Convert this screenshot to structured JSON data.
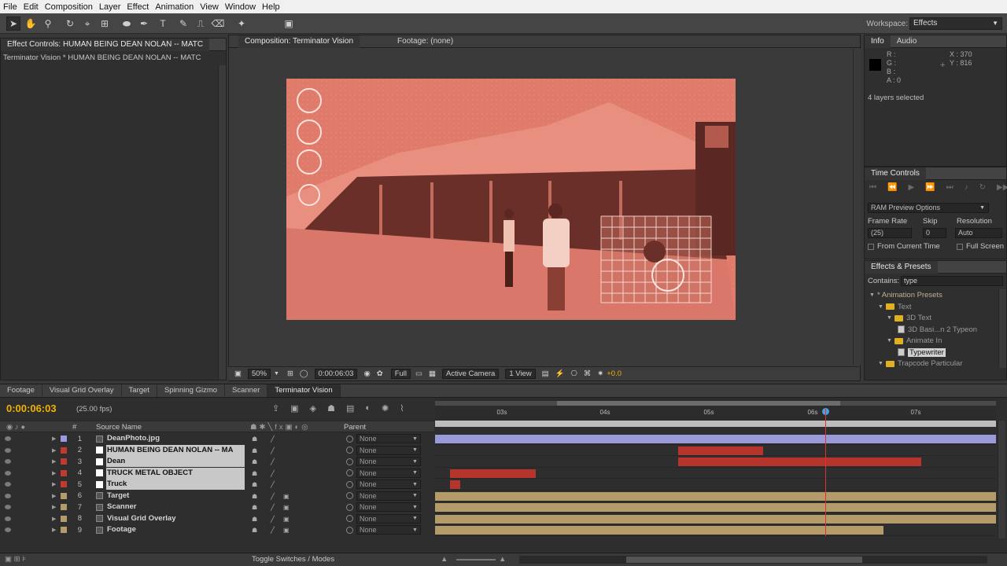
{
  "menu": [
    "File",
    "Edit",
    "Composition",
    "Layer",
    "Effect",
    "Animation",
    "View",
    "Window",
    "Help"
  ],
  "workspace": {
    "label": "Workspace:",
    "value": "Effects"
  },
  "effect_controls": {
    "tab": "Effect Controls: HUMAN BEING DEAN NOLAN -- MATC",
    "subtitle": "Terminator Vision * HUMAN BEING DEAN NOLAN -- MATC"
  },
  "composition": {
    "tab": "Composition: Terminator Vision",
    "footage_tab": "Footage: (none)"
  },
  "viewer_bar": {
    "zoom": "50%",
    "timecode": "0:00:06:03",
    "resolution": "Full",
    "camera": "Active Camera",
    "views": "1 View",
    "exposure": "+0.0"
  },
  "info": {
    "tabs": [
      "Info",
      "Audio"
    ],
    "r": "R :",
    "g": "G :",
    "b": "B :",
    "a": "A : 0",
    "x": "X : 370",
    "y": "Y : 816",
    "status": "4 layers selected"
  },
  "time_controls": {
    "tab": "Time Controls"
  },
  "ram_preview": {
    "title": "RAM Preview Options",
    "frame_rate_label": "Frame Rate",
    "skip_label": "Skip",
    "resolution_label": "Resolution",
    "frame_rate": "(25)",
    "skip": "0",
    "resolution": "Auto",
    "from_current": "From Current Time",
    "full_screen": "Full Screen"
  },
  "effects_presets": {
    "tab": "Effects & Presets",
    "contains_label": "Contains:",
    "contains_value": "type",
    "tree": [
      {
        "label": "* Animation Presets",
        "indent": 0,
        "kind": "root"
      },
      {
        "label": "Text",
        "indent": 1,
        "kind": "folder"
      },
      {
        "label": "3D Text",
        "indent": 2,
        "kind": "folder"
      },
      {
        "label": "3D Basi...n 2 Typeon",
        "indent": 3,
        "kind": "file"
      },
      {
        "label": "Animate In",
        "indent": 2,
        "kind": "folder"
      },
      {
        "label": "Typewriter",
        "indent": 3,
        "kind": "file",
        "selected": true
      },
      {
        "label": "Trapcode Particular",
        "indent": 1,
        "kind": "folder"
      }
    ]
  },
  "timeline": {
    "tabs": [
      "Footage",
      "Visual Grid Overlay",
      "Target",
      "Spinning Gizmo",
      "Scanner",
      "Terminator Vision"
    ],
    "active_tab": "Terminator Vision",
    "timecode": "0:00:06:03",
    "fps": "(25.00 fps)",
    "headers": {
      "num": "#",
      "source": "Source Name",
      "parent": "Parent"
    },
    "ticks": [
      "03s",
      "04s",
      "05s",
      "06s",
      "07s"
    ],
    "layers": [
      {
        "num": "1",
        "name": "DeanPhoto.jpg",
        "label": "#9a9ae0",
        "selected": false,
        "parent": "None"
      },
      {
        "num": "2",
        "name": "HUMAN BEING DEAN NOLAN -- MA",
        "label": "#c03a30",
        "selected": true,
        "parent": "None"
      },
      {
        "num": "3",
        "name": "Dean",
        "label": "#c03a30",
        "selected": true,
        "parent": "None"
      },
      {
        "num": "4",
        "name": "TRUCK METAL OBJECT",
        "label": "#c03a30",
        "selected": true,
        "parent": "None"
      },
      {
        "num": "5",
        "name": "Truck",
        "label": "#c03a30",
        "selected": true,
        "parent": "None"
      },
      {
        "num": "6",
        "name": "Target",
        "label": "#b59a6a",
        "selected": false,
        "parent": "None"
      },
      {
        "num": "7",
        "name": "Scanner",
        "label": "#b59a6a",
        "selected": false,
        "parent": "None"
      },
      {
        "num": "8",
        "name": "Visual Grid Overlay",
        "label": "#b59a6a",
        "selected": false,
        "parent": "None"
      },
      {
        "num": "9",
        "name": "Footage",
        "label": "#b59a6a",
        "selected": false,
        "parent": "None"
      }
    ],
    "toggle_label": "Toggle Switches / Modes"
  }
}
